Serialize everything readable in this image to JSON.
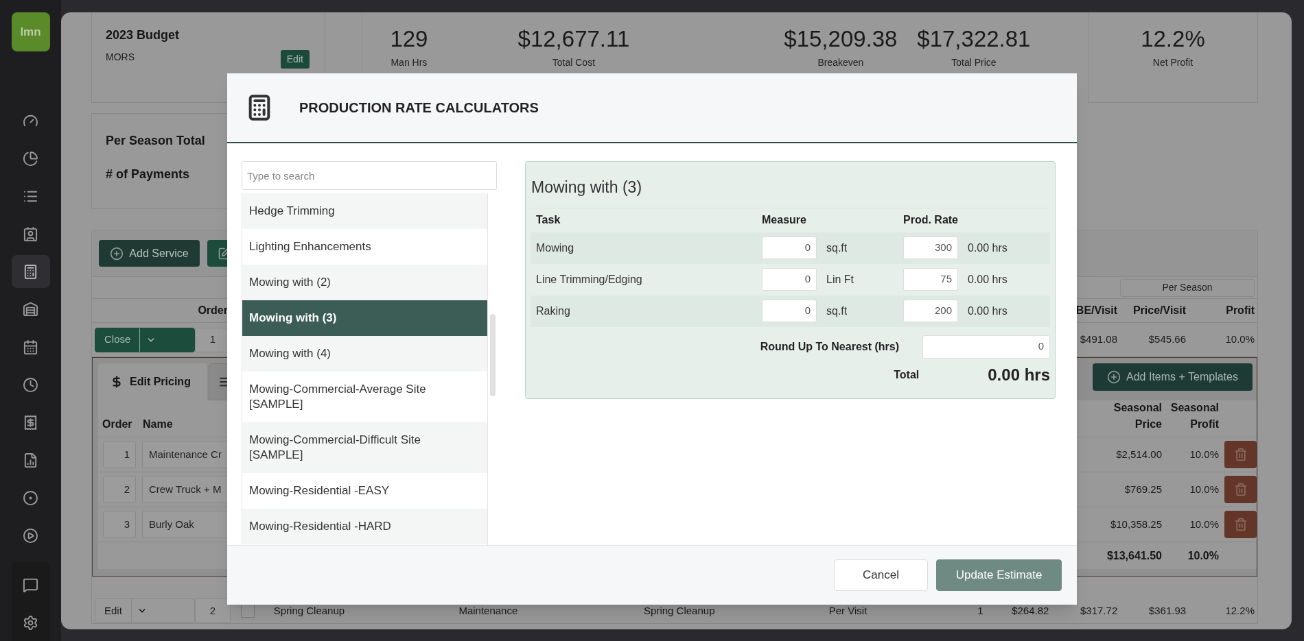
{
  "sidebar": {
    "logo": "lmn",
    "items": [
      {
        "selected": false
      },
      {
        "selected": false
      },
      {
        "selected": false
      },
      {
        "selected": false
      },
      {
        "selected": true
      },
      {
        "selected": false
      },
      {
        "selected": false
      },
      {
        "selected": false
      },
      {
        "selected": false
      },
      {
        "selected": false
      },
      {
        "selected": false
      },
      {
        "selected": false
      }
    ]
  },
  "summary": {
    "title": "2023 Budget",
    "subtitle": "MORS",
    "edit_button": "Edit",
    "stats": [
      {
        "value": "129",
        "label": "Man Hrs"
      },
      {
        "value": "$12,677.11",
        "label": "Total Cost"
      },
      {
        "value": "$15,209.38",
        "label": "Breakeven"
      },
      {
        "value": "$17,322.81",
        "label": "Total Price"
      },
      {
        "value": "12.2%",
        "label": "Net Profit"
      }
    ]
  },
  "season": {
    "labels": [
      "Per Season Total",
      "# of Payments"
    ]
  },
  "services": {
    "add_button": "Add Service",
    "group_header": "Per Season",
    "order_header": "Order",
    "columns": [
      "BE/Visit",
      "Price/Visit",
      "Profit"
    ],
    "rows": [
      {
        "kind": "expanded",
        "action": "Close",
        "order": "1",
        "values": [
          "$491.08",
          "$545.66",
          "10.0%"
        ],
        "detail": {
          "tabs": [
            {
              "label": "Edit Pricing",
              "selected": true
            },
            {
              "selected": false
            }
          ],
          "add_button": "Add Items + Templates",
          "columns": [
            "Order",
            "Name"
          ],
          "seasonal_columns": [
            "Seasonal Price",
            "Seasonal Profit"
          ],
          "items": [
            {
              "order": "1",
              "name": "Maintenance Cr",
              "seasonal_price": "$2,514.00",
              "seasonal_profit": "10.0%"
            },
            {
              "order": "2",
              "name": "Crew Truck + M",
              "seasonal_price": "$769.25",
              "seasonal_profit": "10.0%"
            },
            {
              "order": "3",
              "name": "Burly Oak",
              "seasonal_price": "$10,358.25",
              "seasonal_profit": "10.0%"
            }
          ],
          "totals": {
            "seasonal_price": "$13,641.50",
            "seasonal_profit": "10.0%"
          }
        }
      },
      {
        "kind": "collapsed",
        "action": "Edit",
        "order": "2",
        "checked": false,
        "cells": [
          "Spring Cleanup",
          "Maintenance",
          "Spring Cleanup",
          "Per Visit",
          "1",
          "$264.82",
          "$317.72",
          "$361.93",
          "12.2%"
        ]
      }
    ]
  },
  "modal": {
    "title": "PRODUCTION RATE CALCULATORS",
    "search_placeholder": "Type to search",
    "list": [
      {
        "label": "Hedge Trimming",
        "selected": false
      },
      {
        "label": "Lighting Enhancements",
        "selected": false
      },
      {
        "label": "Mowing with (2)",
        "selected": false
      },
      {
        "label": "Mowing with (3)",
        "selected": true
      },
      {
        "label": "Mowing with (4)",
        "selected": false
      },
      {
        "label": "Mowing-Commercial-Average Site [SAMPLE]",
        "selected": false
      },
      {
        "label": "Mowing-Commercial-Difficult Site [SAMPLE]",
        "selected": false
      },
      {
        "label": "Mowing-Residential -EASY",
        "selected": false
      },
      {
        "label": "Mowing-Residential -HARD",
        "selected": false
      }
    ],
    "calculator": {
      "title": "Mowing with (3)",
      "columns": [
        "Task",
        "Measure",
        "Prod. Rate"
      ],
      "rows": [
        {
          "task": "Mowing",
          "measure": "0",
          "unit": "sq.ft",
          "rate": "300",
          "hours": "0.00 hrs"
        },
        {
          "task": "Line Trimming/Edging",
          "measure": "0",
          "unit": "Lin Ft",
          "rate": "75",
          "hours": "0.00 hrs"
        },
        {
          "task": "Raking",
          "measure": "0",
          "unit": "sq.ft",
          "rate": "200",
          "hours": "0.00 hrs"
        }
      ],
      "round_label": "Round Up To Nearest (hrs)",
      "round_value": "0",
      "total_label": "Total",
      "total": "0.00 hrs"
    },
    "buttons": [
      {
        "label": "Cancel",
        "kind": "secondary"
      },
      {
        "label": "Update Estimate",
        "kind": "primary"
      }
    ]
  }
}
